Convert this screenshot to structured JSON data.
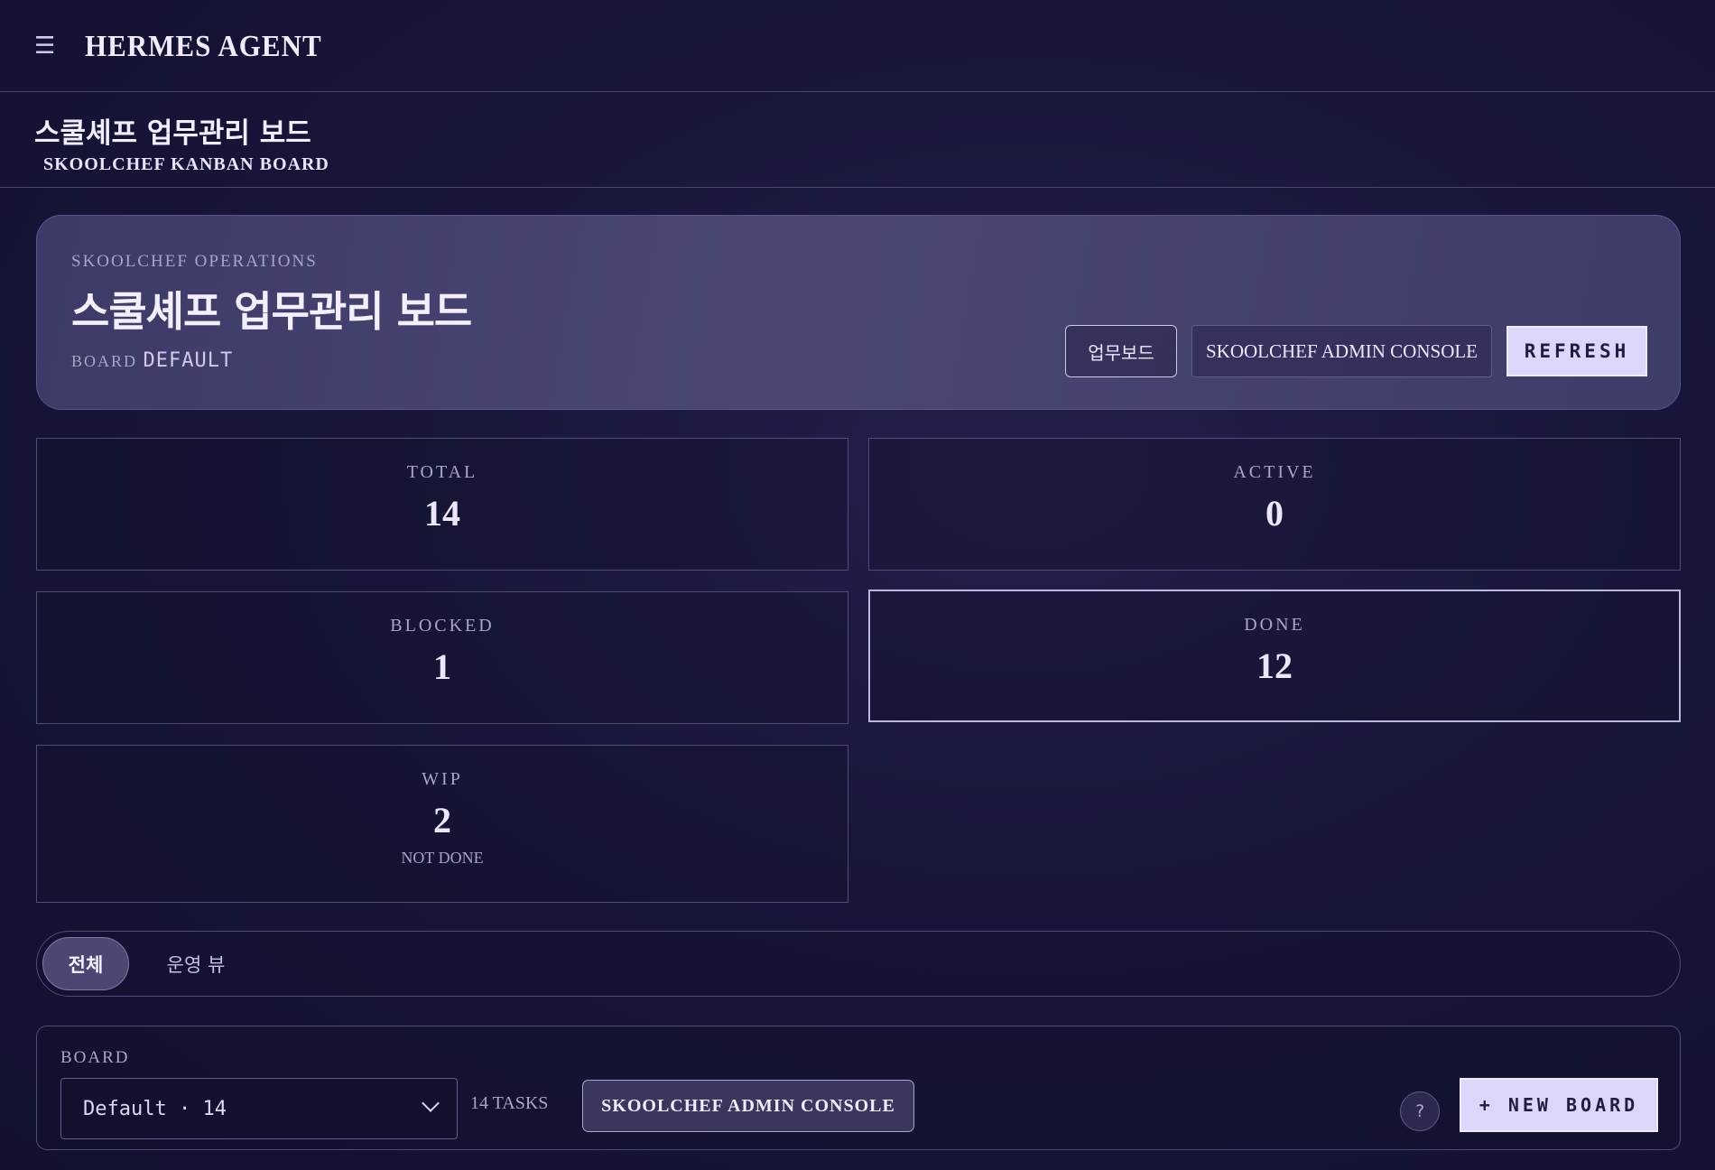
{
  "app": {
    "menu_icon": "hamburger-icon",
    "brand": "HERMES AGENT"
  },
  "page_header": {
    "title_ko": "스쿨셰프 업무관리 보드",
    "title_en": "SKOOLCHEF KANBAN BOARD"
  },
  "hero": {
    "eyebrow": "SKOOLCHEF OPERATIONS",
    "title": "스쿨셰프 업무관리 보드",
    "board_label": "BOARD",
    "board_value": "DEFAULT",
    "buttons": {
      "kanban": "업무보드",
      "admin_console": "SKOOLCHEF ADMIN CONSOLE",
      "refresh": "REFRESH"
    }
  },
  "stats": {
    "total": {
      "label": "TOTAL",
      "value": "14"
    },
    "active": {
      "label": "ACTIVE",
      "value": "0"
    },
    "blocked": {
      "label": "BLOCKED",
      "value": "1"
    },
    "done": {
      "label": "DONE",
      "value": "12"
    },
    "wip": {
      "label": "WIP",
      "value": "2",
      "sub": "NOT DONE"
    }
  },
  "tabs": [
    {
      "label": "전체",
      "active": true
    },
    {
      "label": "운영 뷰",
      "active": false
    }
  ],
  "board_bar": {
    "label": "BOARD",
    "select_value": "Default · 14",
    "task_count": "14 TASKS",
    "admin_console": "SKOOLCHEF ADMIN CONSOLE",
    "help": "?",
    "new_board": "+ NEW BOARD"
  }
}
